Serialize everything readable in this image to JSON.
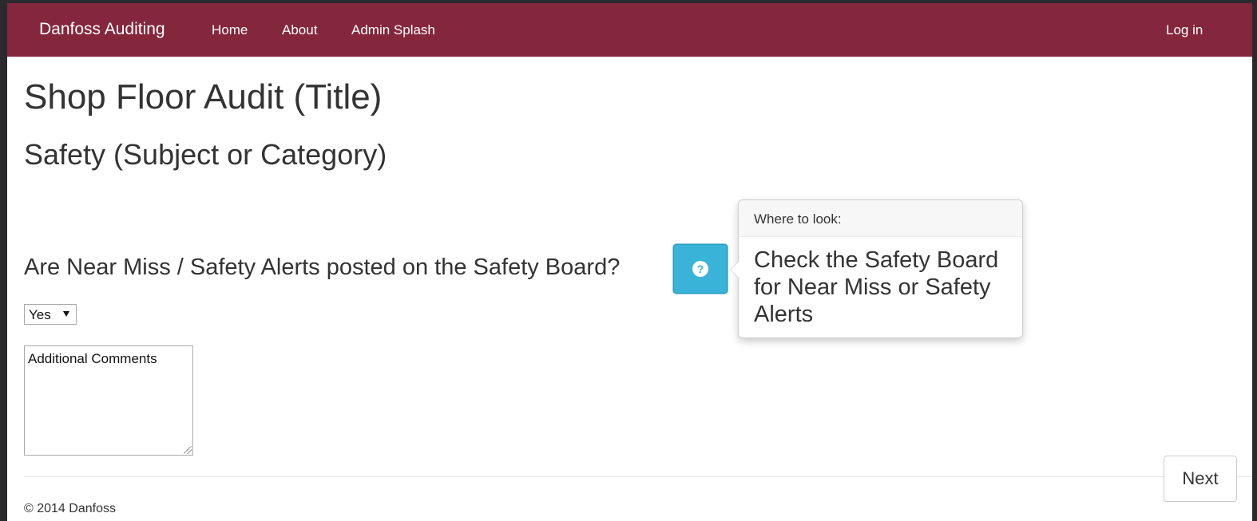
{
  "navbar": {
    "brand": "Danfoss Auditing",
    "links": [
      "Home",
      "About",
      "Admin Splash"
    ],
    "login": "Log in",
    "background": "#84263c"
  },
  "audit": {
    "title": "Shop Floor Audit (Title)",
    "category": "Safety (Subject or Category)",
    "question": "Are Near Miss / Safety Alerts posted on the Safety Board?",
    "help_icon": "question-circle-icon",
    "help_glyph": "?",
    "popover": {
      "title": "Where to look:",
      "content": "Check the Safety Board for Near Miss or Safety Alerts"
    },
    "answer": {
      "selected": "Yes"
    },
    "comments": {
      "placeholder": "Additional Comments"
    }
  },
  "actions": {
    "next_label": "Next"
  },
  "footer": {
    "copyright": "© 2014 Danfoss"
  }
}
